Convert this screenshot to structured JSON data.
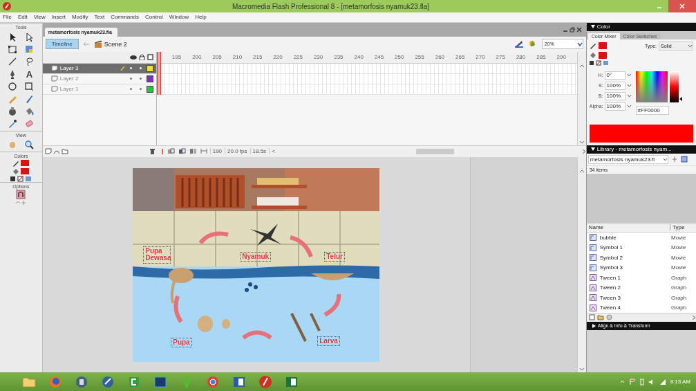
{
  "window": {
    "title": "Macromedia Flash Professional 8 - [metamorfosis nyamuk23.fla]"
  },
  "menu": [
    "File",
    "Edit",
    "View",
    "Insert",
    "Modify",
    "Text",
    "Commands",
    "Control",
    "Window",
    "Help"
  ],
  "tools": {
    "sections": [
      "Tools",
      "View",
      "Colors",
      "Options"
    ],
    "text_tool": "A"
  },
  "document": {
    "tab": "metamorfosis nyamuk23.fla",
    "timeline_button": "Timeline",
    "scene": "Scene 2",
    "zoom": "20%",
    "frame_labels": [
      "195",
      "200",
      "205",
      "210",
      "215",
      "220",
      "225",
      "230",
      "235",
      "240",
      "245",
      "250",
      "255",
      "260",
      "265",
      "270",
      "275",
      "280",
      "285",
      "290"
    ],
    "layers": [
      {
        "name": "Layer 3",
        "selected": true,
        "color": "#f0e030"
      },
      {
        "name": "Layer 2",
        "selected": false,
        "color": "#8030c0"
      },
      {
        "name": "Layer 1",
        "selected": false,
        "color": "#30c040"
      }
    ],
    "status": {
      "frame": "190",
      "fps": "20.0 fps",
      "time": "18.5s",
      "scroll_left": "<"
    }
  },
  "stage": {
    "labels": [
      {
        "text": "Pupa Dewasa"
      },
      {
        "text": "Nyamuk"
      },
      {
        "text": "Telur"
      },
      {
        "text": "Pupa"
      },
      {
        "text": "Larva"
      }
    ]
  },
  "color_panel": {
    "title": "Color",
    "tabs": [
      {
        "label": "Color Mixer",
        "selected": true
      },
      {
        "label": "Color Swatches",
        "selected": false
      }
    ],
    "type_label": "Type:",
    "type_value": "Solid",
    "fields": [
      {
        "label": "H:",
        "value": "0°"
      },
      {
        "label": "S:",
        "value": "100%"
      },
      {
        "label": "B:",
        "value": "100%"
      },
      {
        "label": "Alpha:",
        "value": "100%"
      }
    ],
    "hex": "#FF0000",
    "brightness_slider": {
      "level": 0.1
    }
  },
  "library": {
    "title": "Library - metamorfosis nyam...",
    "file": "metamorfosis nyamuk23.fl",
    "count": "34 items",
    "columns": [
      "Name",
      "Type"
    ],
    "items": [
      {
        "name": "bubble",
        "type": "Movie",
        "kind": "movie"
      },
      {
        "name": "Symbol 1",
        "type": "Movie",
        "kind": "movie"
      },
      {
        "name": "Symbol 2",
        "type": "Movie",
        "kind": "movie"
      },
      {
        "name": "Symbol 3",
        "type": "Movie",
        "kind": "movie"
      },
      {
        "name": "Tween 1",
        "type": "Graph",
        "kind": "graphic"
      },
      {
        "name": "Tween 2",
        "type": "Graph",
        "kind": "graphic"
      },
      {
        "name": "Tween 3",
        "type": "Graph",
        "kind": "graphic"
      },
      {
        "name": "Tween 4",
        "type": "Graph",
        "kind": "graphic"
      }
    ]
  },
  "align_panel": {
    "title": "Align & Info & Transform"
  },
  "taskbar": {
    "time": "8:13 AM"
  }
}
